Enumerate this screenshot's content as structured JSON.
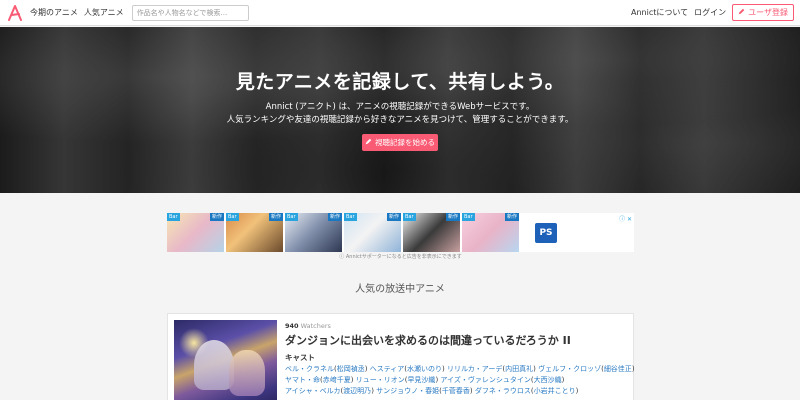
{
  "header": {
    "nav": [
      "今期のアニメ",
      "人気アニメ"
    ],
    "search_placeholder": "作品名や人物名などで検索...",
    "about_label": "Annictについて",
    "login_label": "ログイン",
    "signup_label": "ユーザ登録"
  },
  "hero": {
    "title": "見たアニメを記録して、共有しよう。",
    "desc1": "Annict (アニクト) は、アニメの視聴記録ができるWebサービスです。",
    "desc2": "人気ランキングや友達の視聴記録から好きなアニメを見つけて、管理することができます。",
    "cta_label": "視聴記録を始める"
  },
  "ad": {
    "badge_left": "Bar",
    "badge_new": "新作",
    "ps_label": "PS",
    "note": "Annictサポーターになると広告を非表示にできます"
  },
  "section": {
    "title": "人気の放送中アニメ"
  },
  "card": {
    "watchers_count": "940",
    "watchers_unit": "Watchers",
    "title": "ダンジョンに出会いを求めるのは間違っているだろうか II",
    "cast_heading": "キャスト",
    "cast_rows": [
      [
        {
          "character": "ベル・クラネル",
          "actor": "松岡禎丞"
        },
        {
          "character": "ヘスティア",
          "actor": "水瀬いのり"
        },
        {
          "character": "リリルカ・アーデ",
          "actor": "内田真礼"
        },
        {
          "character": "ヴェルフ・クロッゾ",
          "actor": "細谷佳正"
        }
      ],
      [
        {
          "character": "ヤマト・命",
          "actor": "赤﨑千夏"
        },
        {
          "character": "リュー・リオン",
          "actor": "早見沙織"
        },
        {
          "character": "アイズ・ヴァレンシュタイン",
          "actor": "大西沙織"
        }
      ],
      [
        {
          "character": "アイシャ・ベルカ",
          "actor": "渡辺明乃"
        },
        {
          "character": "サンジョウノ・春姫",
          "actor": "千菅春香"
        },
        {
          "character": "ダフネ・ラウロス",
          "actor": "小岩井ことり"
        }
      ]
    ]
  },
  "colors": {
    "accent": "#f85b73",
    "link": "#2a7bc3"
  }
}
